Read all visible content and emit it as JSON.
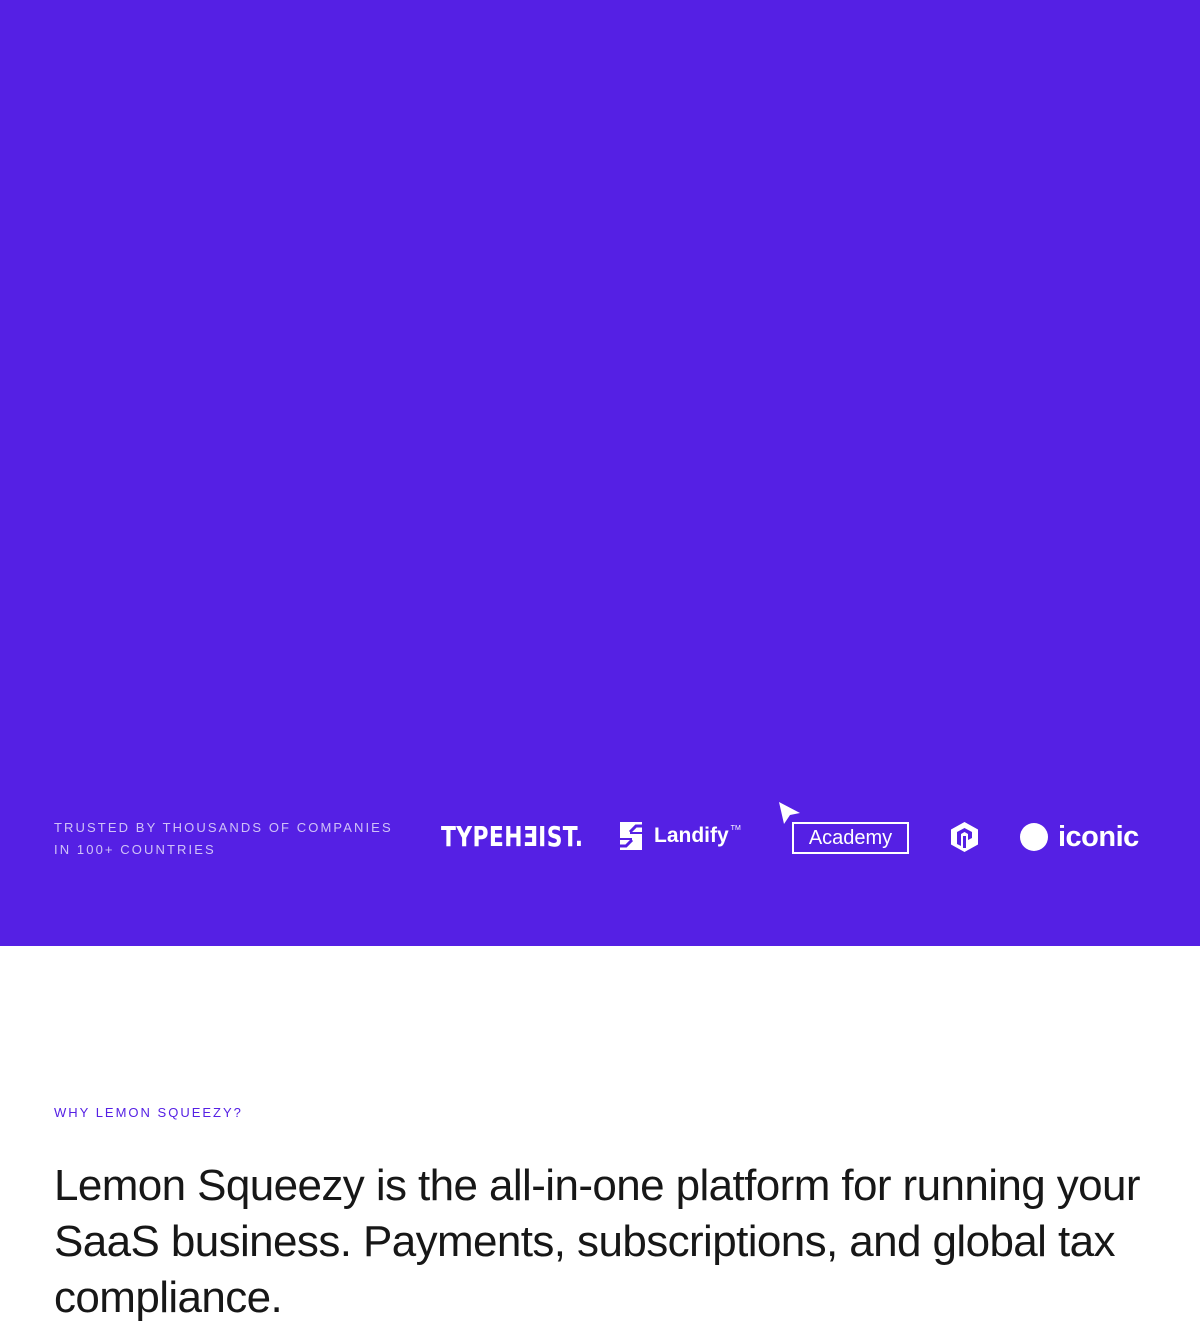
{
  "hero": {
    "background": "#5520e4",
    "trusted_line1": "TRUSTED BY THOUSANDS OF COMPANIES",
    "trusted_line2": "IN 100+ COUNTRIES",
    "logos": {
      "typeheist": "TYPEHƎIST.",
      "landify": "Landify",
      "landify_tm": "TM",
      "academy": "Academy",
      "iconic": "iconic"
    }
  },
  "why": {
    "eyebrow": "WHY LEMON SQUEEZY?",
    "headline": "Lemon Squeezy is the all-in-one platform for running your SaaS business. Payments, subscriptions, and global tax compliance."
  },
  "colors": {
    "accent": "#5520e4",
    "text": "#171717"
  }
}
